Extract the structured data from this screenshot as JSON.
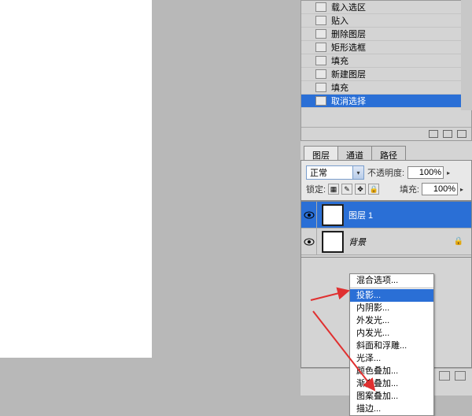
{
  "history": {
    "items": [
      {
        "label": "载入选区",
        "sel": false
      },
      {
        "label": "贴入",
        "sel": false
      },
      {
        "label": "删除图层",
        "sel": false
      },
      {
        "label": "矩形选框",
        "sel": false
      },
      {
        "label": "填充",
        "sel": false
      },
      {
        "label": "新建图层",
        "sel": false
      },
      {
        "label": "填充",
        "sel": false
      },
      {
        "label": "取消选择",
        "sel": true
      }
    ]
  },
  "tabs": {
    "layers": "图层",
    "channels": "通道",
    "paths": "路径"
  },
  "blend": {
    "mode": "正常",
    "opacity_label": "不透明度:",
    "opacity": "100%",
    "lock_label": "锁定:",
    "fill_label": "填充:",
    "fill": "100%"
  },
  "layers": [
    {
      "name": "图层 1",
      "sel": true,
      "locked": false,
      "bg": false
    },
    {
      "name": "背景",
      "sel": false,
      "locked": true,
      "bg": true
    }
  ],
  "ctx": {
    "blend_opts": "混合选项...",
    "drop_shadow": "投影...",
    "inner_shadow": "内阴影...",
    "outer_glow": "外发光...",
    "inner_glow": "内发光...",
    "bevel": "斜面和浮雕...",
    "satin": "光泽...",
    "color_overlay": "颜色叠加...",
    "grad_overlay": "渐变叠加...",
    "patt_overlay": "图案叠加...",
    "stroke": "描边..."
  }
}
